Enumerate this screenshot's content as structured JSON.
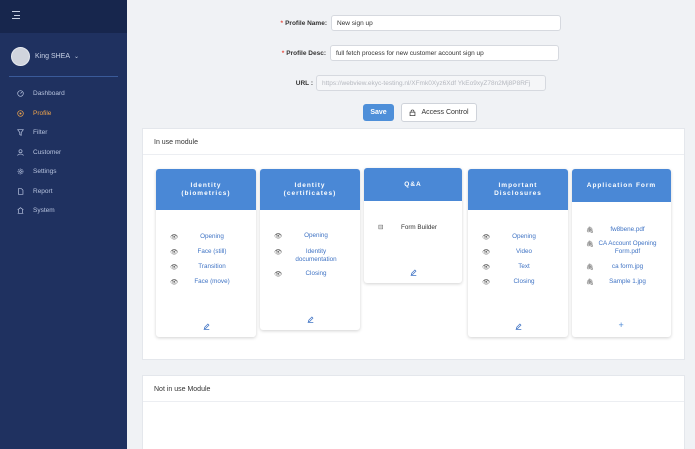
{
  "sidebar": {
    "user_name": "King SHEA",
    "items": [
      {
        "label": "Dashboard",
        "icon": "dashboard-icon",
        "active": false
      },
      {
        "label": "Profile",
        "icon": "profile-icon",
        "active": true
      },
      {
        "label": "Filter",
        "icon": "filter-icon",
        "active": false
      },
      {
        "label": "Customer",
        "icon": "customer-icon",
        "active": false
      },
      {
        "label": "Settings",
        "icon": "settings-icon",
        "active": false
      },
      {
        "label": "Report",
        "icon": "report-icon",
        "active": false
      },
      {
        "label": "System",
        "icon": "system-icon",
        "active": false
      }
    ]
  },
  "form": {
    "name_label": "Profile Name",
    "name_value": "New sign up",
    "desc_label": "Profile Desc",
    "desc_value": "full fetch process for new customer account sign up",
    "url_label": "URL",
    "url_value": "https://webview.ekyc-testing.nl/XFmk0Xyz6Xdf YkEo9xyZ78n2Mj8P8RFj",
    "save_label": "Save",
    "access_label": "Access Control"
  },
  "in_use": {
    "title": "In use module",
    "cards": [
      {
        "title_line1": "Identity",
        "title_line2": "(biometrics)",
        "items": [
          "Opening",
          "Face (still)",
          "Transition",
          "Face (move)"
        ]
      },
      {
        "title_line1": "Identity",
        "title_line2": "(certificates)",
        "items": [
          "Opening",
          "Identity documentation",
          "Closing"
        ]
      },
      {
        "title_line1": "Q&A",
        "title_line2": "",
        "items": [
          "Form Builder"
        ]
      },
      {
        "title_line1": "Important",
        "title_line2": "Disclosures",
        "items": [
          "Opening",
          "Video",
          "Text",
          "Closing"
        ]
      },
      {
        "title_line1": "Application Form",
        "title_line2": "",
        "items": [
          "fw8bene.pdf",
          "CA Account Opening Form.pdf",
          "ca form.jpg",
          "Sample 1.jpg"
        ]
      }
    ]
  },
  "not_in_use": {
    "title": "Not in use Module"
  },
  "colors": {
    "sidebar_bg": "#1f3160",
    "active_nav": "#f0a54c",
    "card_header": "#4a88d6",
    "save_button": "#4e8fd9",
    "required": "#e54d42"
  }
}
